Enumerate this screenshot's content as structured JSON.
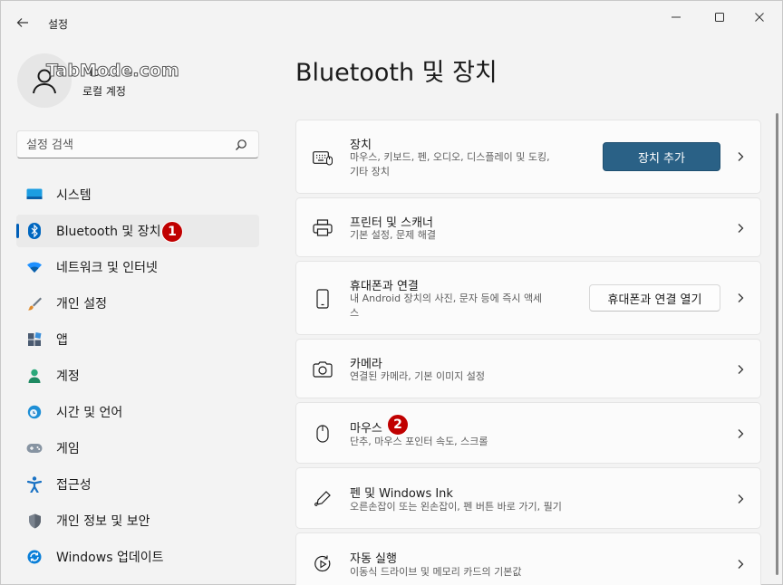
{
  "window": {
    "title": "설정",
    "back_icon": "back-arrow-icon",
    "controls": [
      "minimize-icon",
      "maximize-icon",
      "close-icon"
    ]
  },
  "profile": {
    "name": "Mo...",
    "watermark": "TabMode.com",
    "account_type": "로컬 계정"
  },
  "search": {
    "placeholder": "설정 검색",
    "icon": "search-icon"
  },
  "sidebar": {
    "items": [
      {
        "label": "시스템",
        "icon": "system-display-icon",
        "color": "#0078d4"
      },
      {
        "label": "Bluetooth 및 장치",
        "icon": "bluetooth-icon",
        "color": "#0067c0",
        "active": true
      },
      {
        "label": "네트워크 및 인터넷",
        "icon": "wifi-icon",
        "color": "#0078d4"
      },
      {
        "label": "개인 설정",
        "icon": "brush-icon",
        "color": "#d87b2a"
      },
      {
        "label": "앱",
        "icon": "apps-icon",
        "color": "#4a5a70"
      },
      {
        "label": "계정",
        "icon": "account-icon",
        "color": "#2aa87a"
      },
      {
        "label": "시간 및 언어",
        "icon": "clock-globe-icon",
        "color": "#1e8fd6"
      },
      {
        "label": "게임",
        "icon": "gamepad-icon",
        "color": "#7a8696"
      },
      {
        "label": "접근성",
        "icon": "accessibility-icon",
        "color": "#1a72c4"
      },
      {
        "label": "개인 정보 및 보안",
        "icon": "shield-icon",
        "color": "#6b7480"
      },
      {
        "label": "Windows 업데이트",
        "icon": "update-icon",
        "color": "#0078d4"
      }
    ]
  },
  "badges": {
    "one": "1",
    "two": "2",
    "color": "#c00000"
  },
  "main": {
    "title": "Bluetooth 및 장치",
    "cards": [
      {
        "title": "장치",
        "subtitle_line1": "마우스, 키보드, 펜, 오디오, 디스플레이 및 도킹,",
        "subtitle_line2": "기타 장치",
        "icon": "keyboard-icon",
        "button": "장치 추가"
      },
      {
        "title": "프린터 및 스캐너",
        "subtitle_line1": "기본 설정, 문제 해결",
        "icon": "printer-icon"
      },
      {
        "title": "휴대폰과 연결",
        "subtitle_line1": "내 Android 장치의 사진, 문자 등에 즉시 액세",
        "subtitle_line2": "스",
        "icon": "phone-icon",
        "button": "휴대폰과 연결 열기"
      },
      {
        "title": "카메라",
        "subtitle_line1": "연결된 카메라, 기본 이미지 설정",
        "icon": "camera-icon"
      },
      {
        "title": "마우스",
        "subtitle_line1": "단추, 마우스 포인터 속도, 스크롤",
        "icon": "mouse-icon"
      },
      {
        "title": "펜 및 Windows Ink",
        "subtitle_line1": "오른손잡이 또는 왼손잡이, 펜 버튼 바로 가기, 필기",
        "icon": "pen-icon"
      },
      {
        "title": "자동 실행",
        "subtitle_line1": "이동식 드라이브 및 메모리 카드의 기본값",
        "icon": "autoplay-icon"
      }
    ]
  },
  "accent_color": "#2a6186"
}
